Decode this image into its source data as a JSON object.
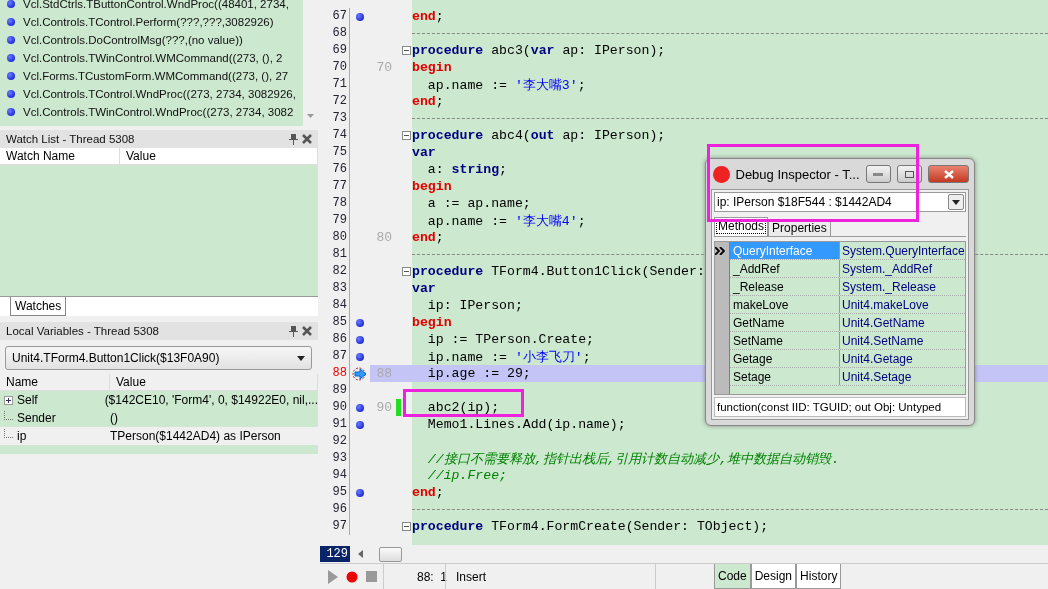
{
  "call_stack": {
    "items": [
      {
        "text": "Vcl.StdCtrls.TButtonControl.WndProc((48401, 2734,"
      },
      {
        "text": "Vcl.Controls.TControl.Perform(???,???,3082926)"
      },
      {
        "text": "Vcl.Controls.DoControlMsg(???,(no value))"
      },
      {
        "text": "Vcl.Controls.TWinControl.WMCommand((273, (), 2"
      },
      {
        "text": "Vcl.Forms.TCustomForm.WMCommand((273, (), 27"
      },
      {
        "text": "Vcl.Controls.TControl.WndProc((273, 2734, 3082926,"
      },
      {
        "text": "Vcl.Controls.TWinControl.WndProc((273, 2734, 3082"
      }
    ]
  },
  "watch_list": {
    "title": "Watch List - Thread 5308",
    "columns": [
      "Watch Name",
      "Value"
    ]
  },
  "bottom_tabs": [
    {
      "label": "Watches",
      "selected": true
    }
  ],
  "local_variables": {
    "title": "Local Variables - Thread 5308",
    "frame": "Unit4.TForm4.Button1Click($13F0A90)",
    "columns": [
      "Name",
      "Value"
    ],
    "rows": [
      {
        "name": "Self",
        "value": "($142CE10, 'Form4', 0, $14922E0, nil,...",
        "expandable": true,
        "selected": false
      },
      {
        "name": "Sender",
        "value": "()",
        "expandable": false,
        "selected": false
      },
      {
        "name": "ip",
        "value": "TPerson($1442AD4) as IPerson",
        "expandable": false,
        "selected": true
      }
    ]
  },
  "editor": {
    "lines": [
      {
        "number": "67",
        "breakpoint": true,
        "kind": "code",
        "segments": [
          {
            "kind": "block",
            "text": "end"
          },
          {
            "kind": "plain",
            "text": ";"
          }
        ]
      },
      {
        "number": "68",
        "kind": "separator"
      },
      {
        "number": "69",
        "kind": "code",
        "fold": true,
        "segments": [
          {
            "kind": "keyword",
            "text": "procedure"
          },
          {
            "kind": "plain",
            "text": " abc3("
          },
          {
            "kind": "keyword",
            "text": "var"
          },
          {
            "kind": "plain",
            "text": " ap: IPerson);"
          }
        ]
      },
      {
        "number": "70",
        "marker": "70",
        "kind": "code",
        "segments": [
          {
            "kind": "block",
            "text": "begin"
          }
        ]
      },
      {
        "number": "71",
        "kind": "code",
        "segments": [
          {
            "kind": "plain",
            "text": "  ap.name := "
          },
          {
            "kind": "string",
            "text": "'李大嘴3'"
          },
          {
            "kind": "plain",
            "text": ";"
          }
        ]
      },
      {
        "number": "72",
        "kind": "code",
        "segments": [
          {
            "kind": "block",
            "text": "end"
          },
          {
            "kind": "plain",
            "text": ";"
          }
        ]
      },
      {
        "number": "73",
        "kind": "separator"
      },
      {
        "number": "74",
        "kind": "code",
        "fold": true,
        "segments": [
          {
            "kind": "keyword",
            "text": "procedure"
          },
          {
            "kind": "plain",
            "text": " abc4("
          },
          {
            "kind": "keyword",
            "text": "out"
          },
          {
            "kind": "plain",
            "text": " ap: IPerson);"
          }
        ]
      },
      {
        "number": "75",
        "kind": "code",
        "segments": [
          {
            "kind": "keyword",
            "text": "var"
          }
        ]
      },
      {
        "number": "76",
        "kind": "code",
        "segments": [
          {
            "kind": "plain",
            "text": "  a: "
          },
          {
            "kind": "keyword",
            "text": "string"
          },
          {
            "kind": "plain",
            "text": ";"
          }
        ]
      },
      {
        "number": "77",
        "kind": "code",
        "segments": [
          {
            "kind": "block",
            "text": "begin"
          }
        ]
      },
      {
        "number": "78",
        "kind": "code",
        "segments": [
          {
            "kind": "plain",
            "text": "  a := ap.name;"
          }
        ]
      },
      {
        "number": "79",
        "kind": "code",
        "segments": [
          {
            "kind": "plain",
            "text": "  ap.name := "
          },
          {
            "kind": "string",
            "text": "'李大嘴4'"
          },
          {
            "kind": "plain",
            "text": ";"
          }
        ]
      },
      {
        "number": "80",
        "marker": "80",
        "kind": "code",
        "segments": [
          {
            "kind": "block",
            "text": "end"
          },
          {
            "kind": "plain",
            "text": ";"
          }
        ]
      },
      {
        "number": "81",
        "kind": "separator"
      },
      {
        "number": "82",
        "kind": "code",
        "fold": true,
        "segments": [
          {
            "kind": "keyword",
            "text": "procedure"
          },
          {
            "kind": "plain",
            "text": " TForm4.Button1Click(Sender:"
          }
        ]
      },
      {
        "number": "83",
        "kind": "code",
        "segments": [
          {
            "kind": "keyword",
            "text": "var"
          }
        ]
      },
      {
        "number": "84",
        "kind": "code",
        "segments": [
          {
            "kind": "plain",
            "text": "  ip: IPerson;"
          }
        ]
      },
      {
        "number": "85",
        "breakpoint": true,
        "kind": "code",
        "segments": [
          {
            "kind": "block",
            "text": "begin"
          }
        ]
      },
      {
        "number": "86",
        "breakpoint": true,
        "kind": "code",
        "segments": [
          {
            "kind": "plain",
            "text": "  ip := TPerson.Create;"
          }
        ]
      },
      {
        "number": "87",
        "breakpoint": true,
        "kind": "code",
        "segments": [
          {
            "kind": "plain",
            "text": "  ip.name := "
          },
          {
            "kind": "string",
            "text": "'小李飞刀'"
          },
          {
            "kind": "plain",
            "text": ";"
          }
        ]
      },
      {
        "number": "88",
        "marker": "88",
        "current": true,
        "kind": "code",
        "segments": [
          {
            "kind": "plain",
            "text": "  ip.age := 29;"
          }
        ]
      },
      {
        "number": "89",
        "kind": "code"
      },
      {
        "number": "90",
        "marker": "90",
        "breakpoint": true,
        "modified": true,
        "kind": "code",
        "segments": [
          {
            "kind": "plain",
            "text": "  abc2(ip);"
          }
        ]
      },
      {
        "number": "91",
        "breakpoint": true,
        "kind": "code",
        "segments": [
          {
            "kind": "plain",
            "text": "  Memo1.Lines.Add(ip.name);"
          }
        ]
      },
      {
        "number": "92",
        "kind": "code"
      },
      {
        "number": "93",
        "kind": "code",
        "segments": [
          {
            "kind": "comment",
            "text": "  //接口不需要释放,指针出栈后,引用计数自动减少,堆中数据自动销毁."
          }
        ]
      },
      {
        "number": "94",
        "kind": "code",
        "segments": [
          {
            "kind": "comment",
            "text": "  //ip.Free;"
          }
        ]
      },
      {
        "number": "95",
        "breakpoint": true,
        "kind": "code",
        "segments": [
          {
            "kind": "block",
            "text": "end"
          },
          {
            "kind": "plain",
            "text": ";"
          }
        ]
      },
      {
        "number": "96",
        "kind": "separator"
      },
      {
        "number": "97",
        "kind": "code",
        "fold": true,
        "segments": [
          {
            "kind": "keyword",
            "text": "procedure"
          },
          {
            "kind": "plain",
            "text": " TForm4.FormCreate(Sender: TObject);"
          }
        ]
      }
    ],
    "goto_line": "129"
  },
  "status_bar": {
    "position": "88:  1",
    "mode": "Insert",
    "tabs": [
      {
        "label": "Code",
        "selected": true
      },
      {
        "label": "Design",
        "selected": false
      },
      {
        "label": "History",
        "selected": false
      }
    ]
  },
  "inspector": {
    "title": "Debug Inspector - T...",
    "expression": "ip: IPerson $18F544 : $1442AD4",
    "tabs": [
      {
        "label": "Methods",
        "selected": true
      },
      {
        "label": "Properties",
        "selected": false
      }
    ],
    "rows": [
      {
        "name": "QueryInterface",
        "value": "System.QueryInterface",
        "selected": true
      },
      {
        "name": "_AddRef",
        "value": "System._AddRef",
        "selected": false
      },
      {
        "name": "_Release",
        "value": "System._Release",
        "selected": false
      },
      {
        "name": "makeLove",
        "value": "Unit4.makeLove",
        "selected": false
      },
      {
        "name": "GetName",
        "value": "Unit4.GetName",
        "selected": false
      },
      {
        "name": "SetName",
        "value": "Unit4.SetName",
        "selected": false
      },
      {
        "name": "Getage",
        "value": "Unit4.Getage",
        "selected": false
      },
      {
        "name": "Setage",
        "value": "Unit4.Setage",
        "selected": false
      }
    ],
    "footer": "function(const IID: TGUID; out Obj: Untyped"
  }
}
